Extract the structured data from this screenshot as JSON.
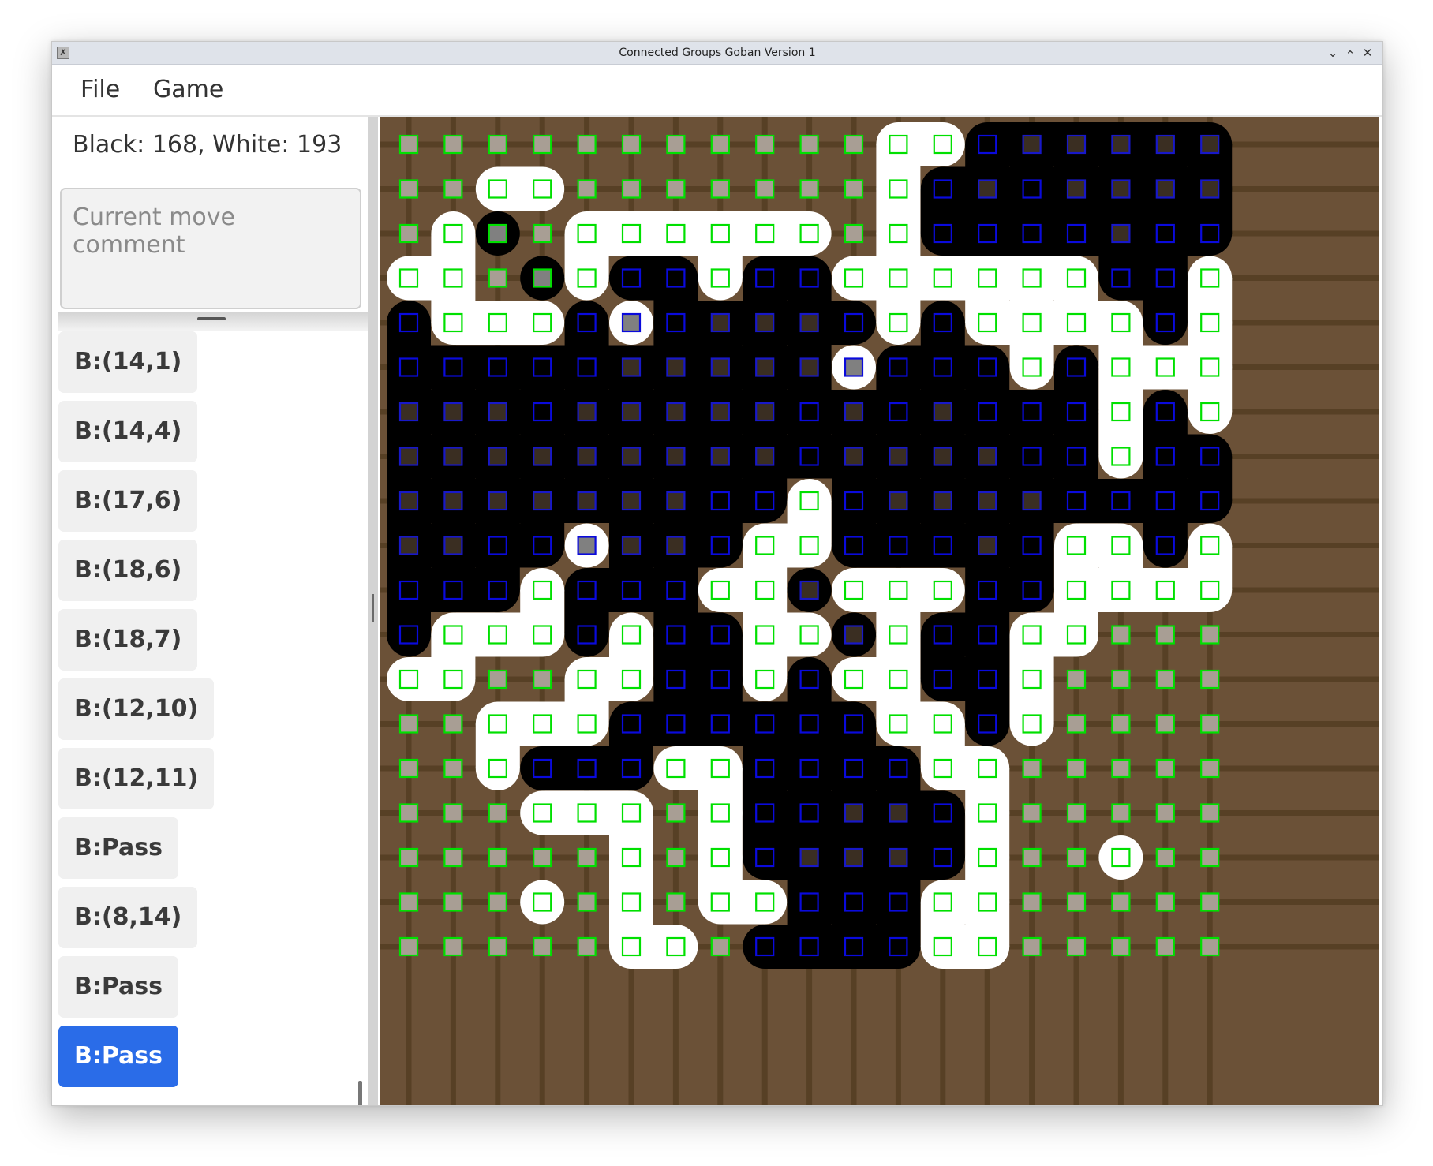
{
  "window": {
    "title": "Connected Groups Goban Version 1",
    "controls": [
      "minimize",
      "maximize",
      "close"
    ]
  },
  "menu": {
    "file": "File",
    "game": "Game"
  },
  "score": {
    "text": "Black: 168, White: 193"
  },
  "comment": {
    "placeholder": "Current move comment",
    "value": ""
  },
  "moves": [
    {
      "label": "B:(14,1)"
    },
    {
      "label": "B:(14,4)"
    },
    {
      "label": "B:(17,6)"
    },
    {
      "label": "B:(18,6)"
    },
    {
      "label": "B:(18,7)"
    },
    {
      "label": "B:(12,10)"
    },
    {
      "label": "B:(12,11)"
    },
    {
      "label": "B:Pass"
    },
    {
      "label": "B:(8,14)"
    },
    {
      "label": "B:Pass"
    },
    {
      "label": "B:Pass",
      "current": true
    }
  ],
  "icons": {
    "app": "x-app-icon",
    "minimize": "chevron-down-icon",
    "maximize": "chevron-up-icon",
    "close": "close-icon"
  },
  "colors": {
    "board_wood": "#6b5137",
    "grid_line": "#574025",
    "black_stone": "#000000",
    "white_stone": "#ffffff",
    "white_territory_marker": "#00e000",
    "black_territory_marker": "#0a0adc",
    "neutral_fill": "#a89e94",
    "dead_stone_fill": "#808080",
    "selected_move": "#2a6ce8"
  },
  "board": {
    "size": 19,
    "legend": {
      ".": "empty point, neutral (grey fill, green outline)",
      "w": "white stone (white region, green marker)",
      "b": "black stone (black region, blue marker)",
      "k": "empty point, black area (dark fill, blue outline)",
      "x": "dead stone in black area (black region, grey fill, green marker)",
      "d": "dead stone in white area (white region, grey fill, blue marker)"
    },
    "rows": [
      "...........wwbkkkkk",
      "..ww.......wbkbkkkk",
      ".wx.wwwwww.wbbbbkbb",
      "ww.xwbbwbbwwwwwwbbw",
      "bwwwbdbkkkbwbwwwwbw",
      "bbbbbkkkkkdbbbwbwww",
      "kkkbkkkkkbkbkbbbwbw",
      "kkkkkkkkkbkkkkbbwbb",
      "kkkkkkkbbwbkkkkbbbb",
      "kkbbdkkbwwbbbkbwwbw",
      "bbbwbbbwwkwwwbbwwww",
      "bwwwbwbbwwkwbbww...",
      "ww..wwbbwbwwbbw....",
      "..wwwbbbbbbwwbw....",
      "..wbbbwwbbbbww.....",
      "...www.wbbkkbw.....",
      ".....w.wbkkkbw..w..",
      "...w.w.wwbbbww.....",
      ".....ww.bbbbww....."
    ]
  }
}
